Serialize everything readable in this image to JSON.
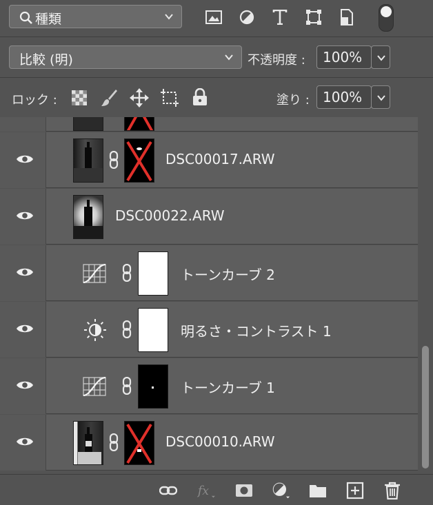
{
  "filter": {
    "label": "種類"
  },
  "blend": {
    "mode": "比較 (明)",
    "opacity_label": "不透明度 :",
    "opacity_value": "100%"
  },
  "lock": {
    "label": "ロック :",
    "fill_label": "塗り :",
    "fill_value": "100%"
  },
  "layers": [
    {
      "name": "DSC00017.ARW",
      "type": "pixel-with-mask"
    },
    {
      "name": "DSC00022.ARW",
      "type": "pixel"
    },
    {
      "name": "トーンカーブ 2",
      "type": "curves-adjustment"
    },
    {
      "name": "明るさ・コントラスト 1",
      "type": "brightness-contrast-adjustment"
    },
    {
      "name": "トーンカーブ 1",
      "type": "curves-adjustment"
    },
    {
      "name": "DSC00010.ARW",
      "type": "pixel-with-mask"
    }
  ],
  "colors": {
    "panel": "#535353",
    "layer_bg": "#5e5e5e",
    "mask_x": "#e0302a"
  },
  "icons": {
    "filter_types": [
      "image-filter-icon",
      "adjustment-filter-icon",
      "type-filter-icon",
      "shape-filter-icon",
      "smartobject-filter-icon"
    ],
    "locks": [
      "lock-transparent-icon",
      "lock-paint-icon",
      "lock-position-icon",
      "lock-artboard-icon",
      "lock-all-icon"
    ],
    "bottom": [
      "link-layers-icon",
      "fx-icon",
      "add-mask-icon",
      "new-adjustment-icon",
      "new-group-icon",
      "new-layer-icon",
      "delete-layer-icon"
    ]
  }
}
